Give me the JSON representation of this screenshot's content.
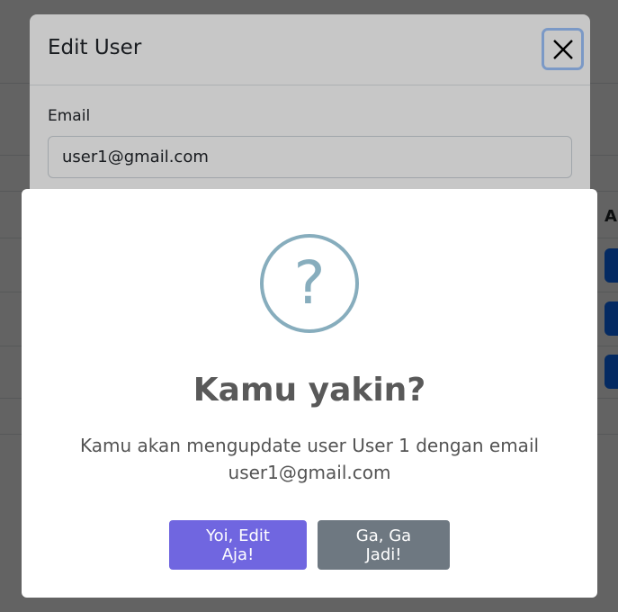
{
  "background": {
    "table_header_partial": "A"
  },
  "edit_modal": {
    "title": "Edit User",
    "email_label": "Email",
    "email_value": "user1@gmail.com"
  },
  "dialog": {
    "icon_symbol": "?",
    "title": "Kamu yakin?",
    "message": "Kamu akan mengupdate user User 1 dengan email user1@gmail.com",
    "confirm_label": "Yoi, Edit Aja!",
    "cancel_label": "Ga, Ga Jadi!"
  },
  "colors": {
    "confirm": "#7066e0",
    "cancel": "#6e7881",
    "question_icon": "#87adbd",
    "action_button": "#0d6efd"
  }
}
